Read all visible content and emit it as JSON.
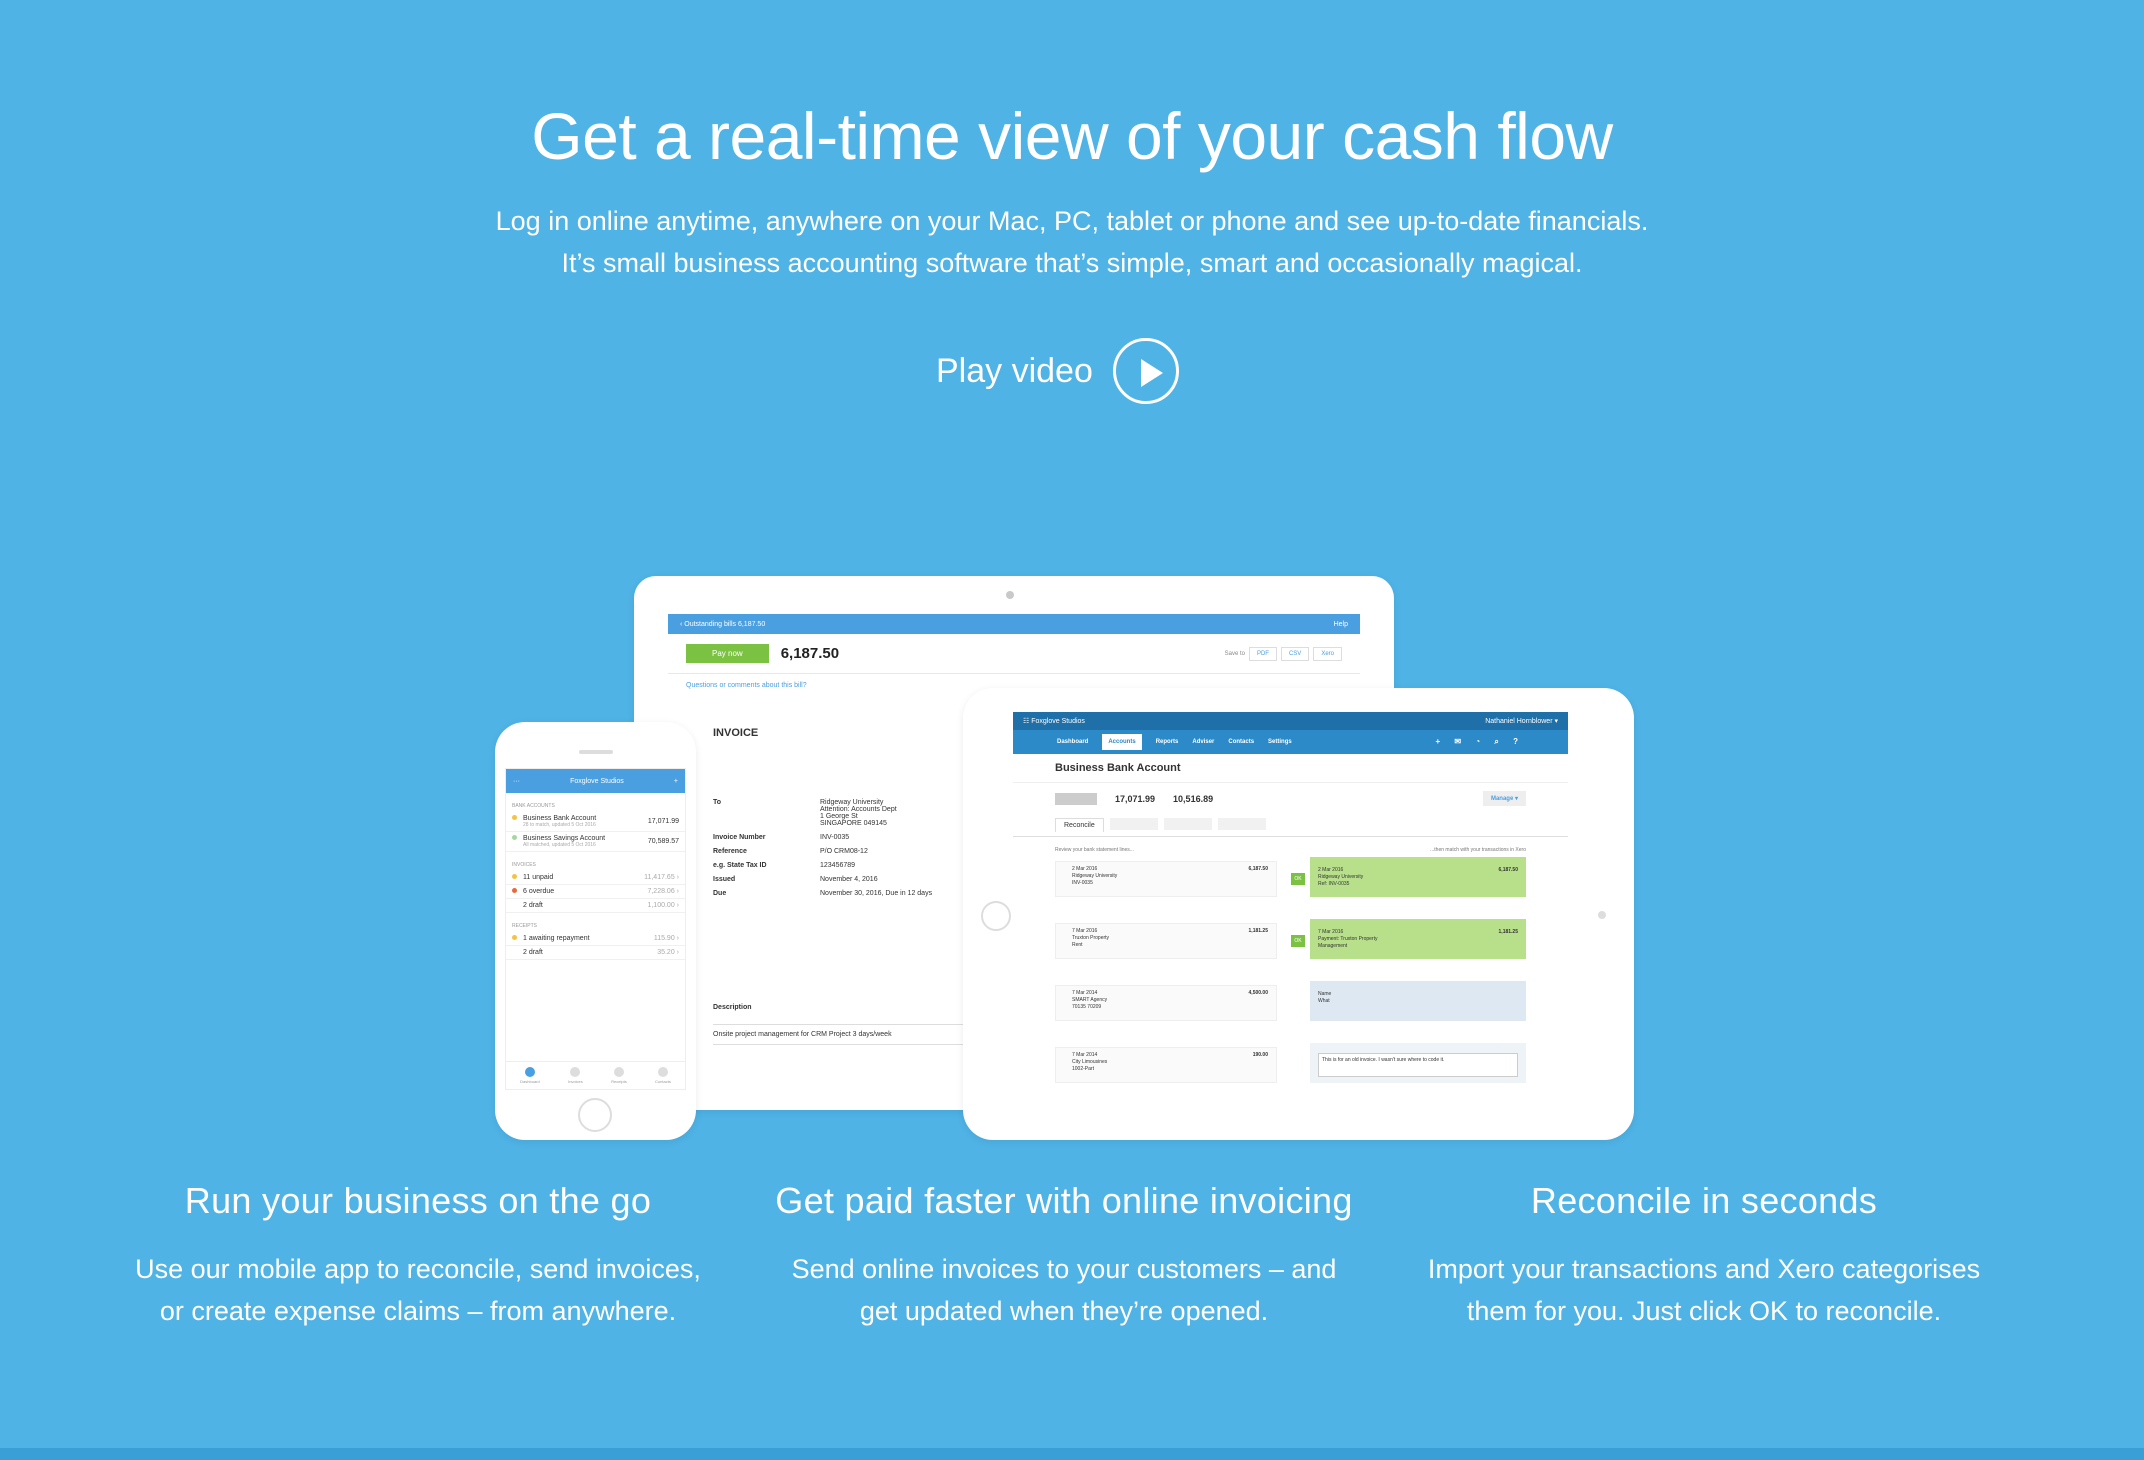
{
  "hero": {
    "title": "Get a real-time view of your cash flow",
    "subtitle_1": "Log in online anytime, anywhere on your Mac, PC, tablet or phone and see up-to-date financials.",
    "subtitle_2": "It’s small business accounting software that’s simple, smart and occasionally magical.",
    "play_label": "Play video",
    "play_icon": "play-circle-icon"
  },
  "invoice": {
    "back_link": "‹ Outstanding bills 6,187.50",
    "help": "Help",
    "pay_now": "Pay now",
    "amount": "6,187.50",
    "save_to": "Save to",
    "formats": [
      "PDF",
      "CSV",
      "Xero"
    ],
    "comments_link": "Questions or comments about this bill?",
    "title": "INVOICE",
    "fields": [
      {
        "k": "To",
        "v": "Ridgeway University\nAttention: Accounts Dept\n1 George St\nSINGAPORE 049145"
      },
      {
        "k": "Invoice Number",
        "v": "INV-0035"
      },
      {
        "k": "Reference",
        "v": "P/O CRM08-12"
      },
      {
        "k": "e.g. State Tax ID",
        "v": "123456789"
      },
      {
        "k": "Issued",
        "v": "November 4, 2016"
      },
      {
        "k": "Due",
        "v": "November 30, 2016, Due in 12 days"
      }
    ],
    "desc_header": "Description",
    "desc_line": "Onsite project management for CRM Project 3 days/week"
  },
  "phone": {
    "menu": "···",
    "org": "Foxglove Studios",
    "plus": "+",
    "sections": {
      "bank": "Bank accounts",
      "invoices": "Invoices",
      "receipts": "Receipts"
    },
    "bank_rows": [
      {
        "label": "Business Bank Account",
        "sub": "28 to match, updated 5 Oct 2016",
        "val": "17,071.99",
        "color": "#f5c242"
      },
      {
        "label": "Business Savings Account",
        "sub": "All matched, updated 5 Oct 2016",
        "val": "70,589.57",
        "color": "#a6d7a0"
      }
    ],
    "invoice_rows": [
      {
        "label": "11 unpaid",
        "val": "11,417.65 ›",
        "color": "#f5c242"
      },
      {
        "label": "6 overdue",
        "val": "7,228.06 ›",
        "color": "#e86a3b"
      },
      {
        "label": "2 draft",
        "val": "1,100.00 ›",
        "color": "transparent"
      }
    ],
    "receipt_rows": [
      {
        "label": "1 awaiting repayment",
        "val": "115.90 ›",
        "color": "#f5c242"
      },
      {
        "label": "2 draft",
        "val": "35.20 ›",
        "color": "transparent"
      }
    ],
    "tabs": [
      "Dashboard",
      "Invoices",
      "Receipts",
      "Contacts"
    ]
  },
  "tablet": {
    "org": "☷ Foxglove Studios",
    "user": "Nathaniel Hornblower ▾",
    "nav": [
      "Dashboard",
      "Accounts",
      "Reports",
      "Adviser",
      "Contacts",
      "Settings"
    ],
    "tools": "+ ✉ ◔ ⌕ ?",
    "title": "Business Bank Account",
    "bal_1": "17,071.99",
    "bal_2": "10,516.89",
    "manage": "Manage ▾",
    "tab_reconcile": "Reconcile",
    "hint_left": "Review your bank statement lines...",
    "hint_right": "...then match with your transactions in Xero",
    "ok": "OK",
    "rows": [
      {
        "date": "2 Mar 2016",
        "who": "Ridgeway University",
        "ref": "INV-0035",
        "amt": "6,187.50",
        "match": "2 Mar 2016\nRidgeway University\nRef: INV-0035",
        "match_amt": "6,187.50"
      },
      {
        "date": "7 Mar 2016",
        "who": "Truxton Property",
        "ref": "Rent",
        "amt": "1,181.25",
        "match": "7 Mar 2016\nPayment: Truxton Property\nManagement",
        "match_amt": "1,181.25"
      },
      {
        "date": "7 Mar 2014",
        "who": "SMART Agency",
        "ref": "70135 70209",
        "amt": "4,500.00",
        "match": "Name\nWhat",
        "match_amt": ""
      },
      {
        "date": "7 Mar 2014",
        "who": "City Limousines",
        "ref": "1002-Part",
        "amt": "190.00",
        "match": "This is for an old invoice. I wasn't sure where to code it.",
        "match_amt": ""
      }
    ]
  },
  "features": [
    {
      "title": "Run your business on the go",
      "line_1": "Use our mobile app to reconcile, send invoices,",
      "line_2": "or create expense claims – from anywhere."
    },
    {
      "title": "Get paid faster with online invoicing",
      "line_1": "Send online invoices to your customers – and",
      "line_2": "get updated when they’re opened."
    },
    {
      "title": "Reconcile in seconds",
      "line_1": "Import your transactions and Xero categorises",
      "line_2": "them for you. Just click OK to reconcile."
    }
  ]
}
